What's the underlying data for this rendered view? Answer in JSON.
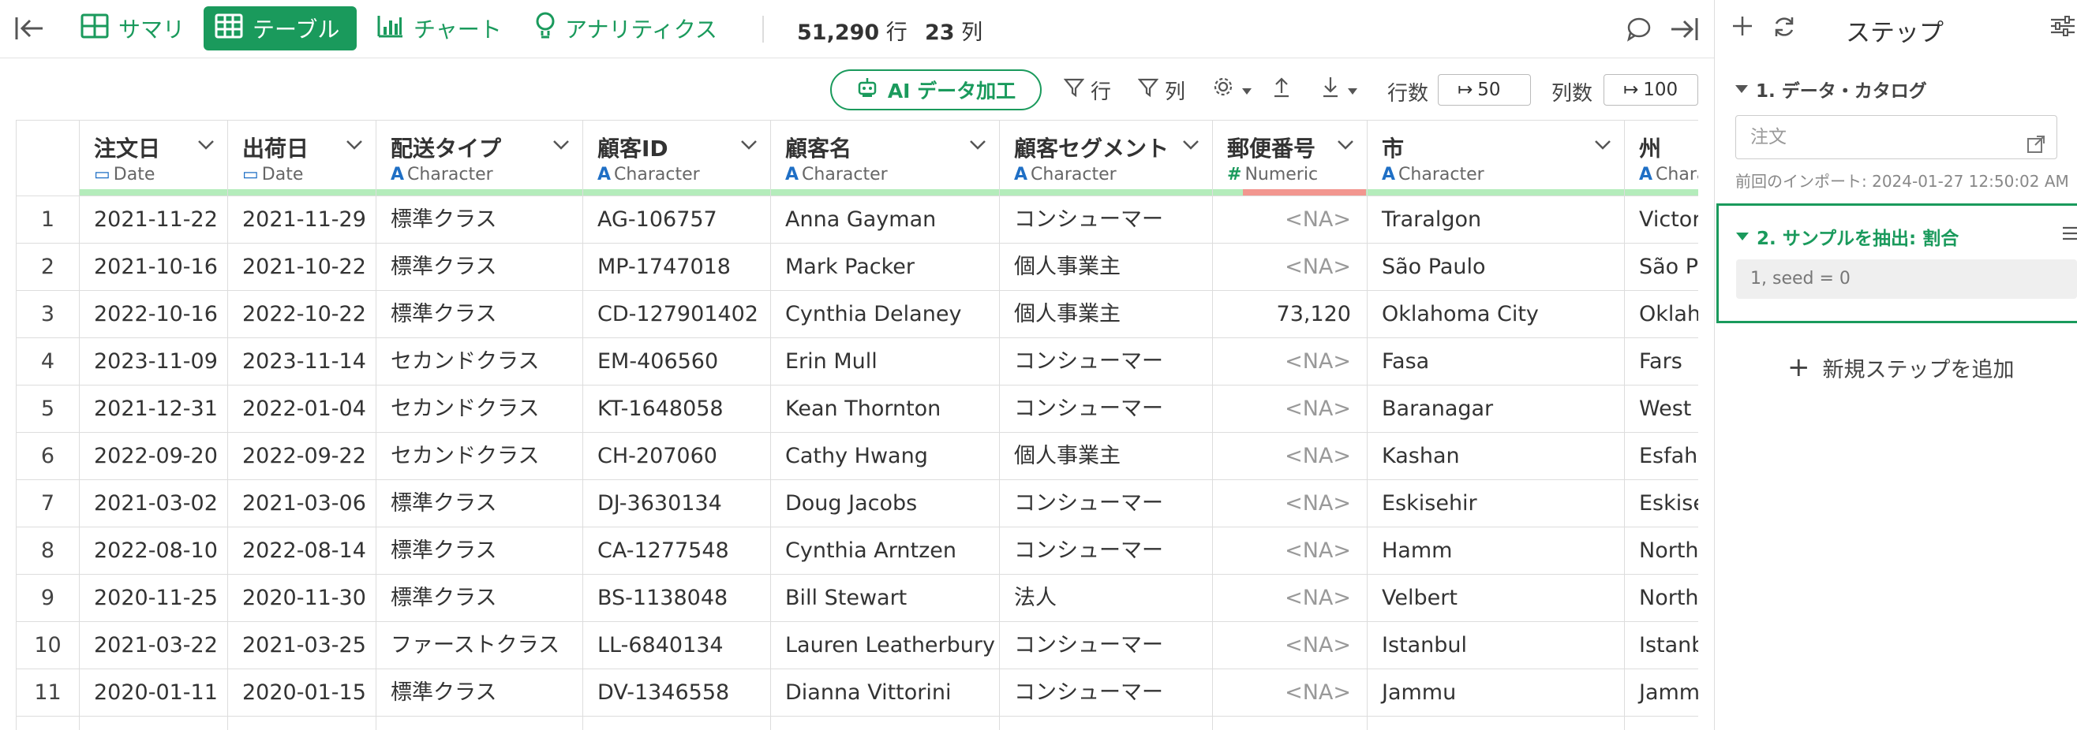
{
  "topbar": {
    "tabs": [
      {
        "label": "サマリ",
        "icon": "summary-grid-icon"
      },
      {
        "label": "テーブル",
        "icon": "table-icon"
      },
      {
        "label": "チャート",
        "icon": "bar-chart-icon"
      },
      {
        "label": "アナリティクス",
        "icon": "lightbulb-icon"
      }
    ],
    "active_tab": "テーブル",
    "rows_count": "51,290",
    "rows_unit": "行",
    "cols_count": "23",
    "cols_unit": "列"
  },
  "toolbar": {
    "ai_button_label": "AI データ加工",
    "filter_rows_label": "行",
    "filter_cols_label": "列",
    "rows_label": "行数",
    "rows_value": "50",
    "cols_label": "列数",
    "cols_value": "100"
  },
  "table": {
    "columns": [
      {
        "name": "注文日",
        "type": "Date",
        "type_icon": "calendar-icon"
      },
      {
        "name": "出荷日",
        "type": "Date",
        "type_icon": "calendar-icon"
      },
      {
        "name": "配送タイプ",
        "type": "Character",
        "type_icon": "A"
      },
      {
        "name": "顧客ID",
        "type": "Character",
        "type_icon": "A"
      },
      {
        "name": "顧客名",
        "type": "Character",
        "type_icon": "A"
      },
      {
        "name": "顧客セグメント",
        "type": "Character",
        "type_icon": "A"
      },
      {
        "name": "郵便番号",
        "type": "Numeric",
        "type_icon": "#"
      },
      {
        "name": "市",
        "type": "Character",
        "type_icon": "A"
      },
      {
        "name": "州",
        "type": "Character",
        "type_icon": "A"
      }
    ],
    "rows": [
      [
        "1",
        "2021-11-22",
        "2021-11-29",
        "標準クラス",
        "AG-106757",
        "Anna Gayman",
        "コンシューマー",
        "<NA>",
        "Traralgon",
        "Victoria"
      ],
      [
        "2",
        "2021-10-16",
        "2021-10-22",
        "標準クラス",
        "MP-1747018",
        "Mark Packer",
        "個人事業主",
        "<NA>",
        "São Paulo",
        "São Paulo"
      ],
      [
        "3",
        "2022-10-16",
        "2022-10-22",
        "標準クラス",
        "CD-127901402",
        "Cynthia Delaney",
        "個人事業主",
        "73,120",
        "Oklahoma City",
        "Oklahoma"
      ],
      [
        "4",
        "2023-11-09",
        "2023-11-14",
        "セカンドクラス",
        "EM-406560",
        "Erin Mull",
        "コンシューマー",
        "<NA>",
        "Fasa",
        "Fars"
      ],
      [
        "5",
        "2021-12-31",
        "2022-01-04",
        "セカンドクラス",
        "KT-1648058",
        "Kean Thornton",
        "コンシューマー",
        "<NA>",
        "Baranagar",
        "West Bengal"
      ],
      [
        "6",
        "2022-09-20",
        "2022-09-22",
        "セカンドクラス",
        "CH-207060",
        "Cathy Hwang",
        "個人事業主",
        "<NA>",
        "Kashan",
        "Esfahan"
      ],
      [
        "7",
        "2021-03-02",
        "2021-03-06",
        "標準クラス",
        "DJ-3630134",
        "Doug Jacobs",
        "コンシューマー",
        "<NA>",
        "Eskisehir",
        "Eskisehir"
      ],
      [
        "8",
        "2022-08-10",
        "2022-08-14",
        "標準クラス",
        "CA-1277548",
        "Cynthia Arntzen",
        "コンシューマー",
        "<NA>",
        "Hamm",
        "North Rhine-Westphalia"
      ],
      [
        "9",
        "2020-11-25",
        "2020-11-30",
        "標準クラス",
        "BS-1138048",
        "Bill Stewart",
        "法人",
        "<NA>",
        "Velbert",
        "North Rhine-Westphalia"
      ],
      [
        "10",
        "2021-03-22",
        "2021-03-25",
        "ファーストクラス",
        "LL-6840134",
        "Lauren Leatherbury",
        "コンシューマー",
        "<NA>",
        "Istanbul",
        "Istanbul"
      ],
      [
        "11",
        "2020-01-11",
        "2020-01-15",
        "標準クラス",
        "DV-1346558",
        "Dianna Vittorini",
        "コンシューマー",
        "<NA>",
        "Jammu",
        "Jammu and Kashmir"
      ]
    ]
  },
  "panel": {
    "title": "ステップ",
    "step1_title": "1. データ・カタログ",
    "catalog_placeholder": "注文",
    "import_time": "前回のインポート: 2024-01-27 12:50:02 AM",
    "step2_title": "2. サンプルを抽出: 割合",
    "step2_detail": "1, seed = 0",
    "add_step_label": "新規ステップを追加"
  },
  "colors": {
    "accent": "#1a9a5c",
    "quality_ok": "#b4ecbb",
    "quality_bad": "#f2968f",
    "type_character": "#1f6fc5",
    "type_numeric": "#1a9a5c"
  }
}
